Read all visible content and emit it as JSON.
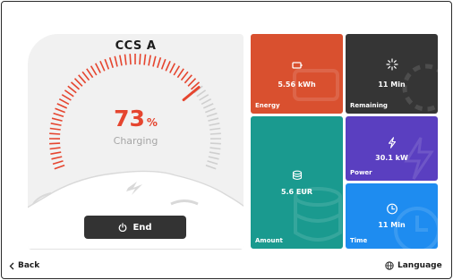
{
  "charger": {
    "title": "CCS A",
    "percent": "73",
    "percent_unit": "%",
    "status": "Charging",
    "charge_level": 0.73
  },
  "end_button": {
    "label": "End",
    "icon": "power-icon"
  },
  "tiles": {
    "energy": {
      "value": "5.56 kWh",
      "label": "Energy",
      "icon": "battery-icon",
      "color": "#d9502f"
    },
    "remaining": {
      "value": "11 Min",
      "label": "Remaining",
      "icon": "loading-icon",
      "color": "#353535"
    },
    "power": {
      "value": "30.1 kW",
      "label": "Power",
      "icon": "lightning-icon",
      "color": "#5a3fc0"
    },
    "amount": {
      "value": "5.6 EUR",
      "label": "Amount",
      "icon": "coins-icon",
      "color": "#1a9a8f"
    },
    "time": {
      "value": "11 Min",
      "label": "Time",
      "icon": "clock-icon",
      "color": "#1e8cf0"
    }
  },
  "footer": {
    "back_label": "Back",
    "language_label": "Language"
  }
}
